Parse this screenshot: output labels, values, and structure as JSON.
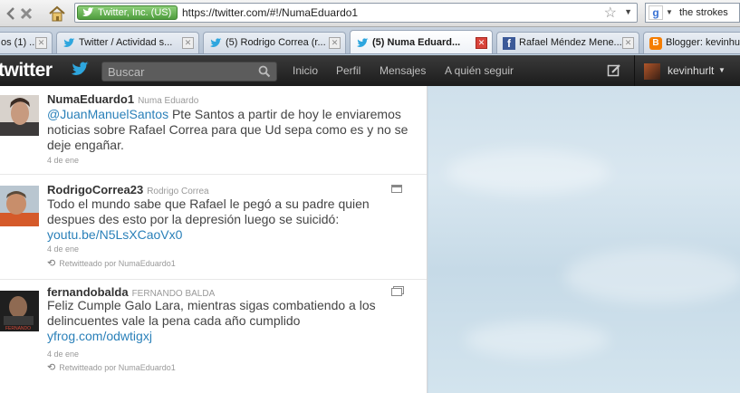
{
  "browser": {
    "site_identity": "Twitter, Inc. (US)",
    "url": "https://twitter.com/#!/NumaEduardo1",
    "search_query": "the strokes",
    "nav_icons": [
      "back-arrow-icon",
      "stop-icon",
      "home-icon"
    ]
  },
  "tabs": [
    {
      "label": "os (1) ...",
      "icon": "generic-page-icon"
    },
    {
      "label": "Twitter / Actividad s...",
      "icon": "twitter-bird-icon"
    },
    {
      "label": "(5) Rodrigo Correa (r...",
      "icon": "twitter-bird-icon"
    },
    {
      "label": "(5) Numa Eduard...",
      "icon": "twitter-bird-icon",
      "active": true
    },
    {
      "label": "Rafael Méndez Mene...",
      "icon": "facebook-icon"
    },
    {
      "label": "Blogger: kevinhu",
      "icon": "blogger-icon"
    }
  ],
  "twitter": {
    "logo": "twitter",
    "search_placeholder": "Buscar",
    "nav": {
      "home": "Inicio",
      "profile": "Perfil",
      "messages": "Mensajes",
      "who_to_follow": "A quién seguir"
    },
    "user": "kevinhurlt"
  },
  "tweets": [
    {
      "username": "NumaEduardo1",
      "fullname": "Numa Eduardo",
      "mention": "@JuanManuelSantos",
      "text": " Pte Santos a partir de hoy le enviaremos noticias sobre Rafael Correa para que Ud sepa como es y no se deje engañar.",
      "date": "4 de ene"
    },
    {
      "username": "RodrigoCorrea23",
      "fullname": "Rodrigo Correa",
      "text": "Todo el mundo sabe que Rafael le pegó a su padre quien despues des esto por la depresión luego se suicidó:",
      "link": "youtu.be/N5LsXCaoVx0",
      "date": "4 de ene",
      "retweeted_by": "Retwitteado por NumaEduardo1"
    },
    {
      "username": "fernandobalda",
      "fullname": "FERNANDO BALDA",
      "text": "Feliz Cumple Galo Lara, mientras sigas combatiendo a los delincuentes vale la pena cada año cumplido",
      "link": "yfrog.com/odwtigxj",
      "date": "4 de ene",
      "retweeted_by": "Retwitteado por NumaEduardo1",
      "avatar_caption": "FERNANDO"
    }
  ],
  "colors": {
    "link": "#2a80b9",
    "topbar": "#262626",
    "background": "#c9dbe8"
  }
}
